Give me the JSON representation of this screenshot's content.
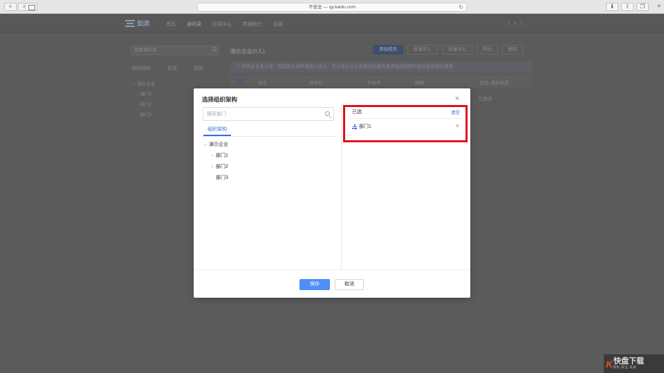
{
  "browser": {
    "url": "不安全 — qy.baidu.com",
    "back_label": "<",
    "forward_label": ">",
    "reload_label": "↻",
    "newtab_label": "+"
  },
  "app": {
    "logo": "如流",
    "nav": [
      "首页",
      "通讯录",
      "应用中心",
      "数据统计",
      "设置"
    ],
    "nav_active_index": 1,
    "nav_right": "\\ = \\",
    "sidebar": {
      "search_placeholder": "搜索通讯录",
      "tabs": [
        "组织结构",
        "标签",
        "高管"
      ],
      "tree_root": "演示企业",
      "tree_children": [
        "部门1",
        "部门2",
        "部门3"
      ]
    },
    "main": {
      "title": "演示企业(0人)",
      "buttons": [
        "添加成员",
        "批量导入",
        "批量导出",
        "移动",
        "删除"
      ],
      "notice": "你的企业未认证，需成员主动申请加入企业，去认证企业认证通过后通讯录添加成员即可自动发送短信邀请",
      "columns": [
        "姓名",
        "成员ID",
        "手机号",
        "邮箱",
        "状态: 成员状态"
      ],
      "row_status": "已激活"
    }
  },
  "modal": {
    "title": "选择组织架构",
    "close_label": "×",
    "search_placeholder": "搜索部门",
    "tab_label": "组织架构",
    "tree": {
      "root": "演示企业",
      "children": [
        {
          "label": "部门1",
          "expandable": true
        },
        {
          "label": "部门2",
          "expandable": true
        },
        {
          "label": "部门3",
          "expandable": false
        }
      ]
    },
    "selected_header": "已选",
    "clear_label": "清空",
    "selected_items": [
      "部门1"
    ],
    "save_label": "保存",
    "cancel_label": "取消"
  },
  "watermark": {
    "mark": "K",
    "title": "快盘下载",
    "subtitle": "绿色·安全·高速"
  },
  "colors": {
    "accent": "#4d8ff7",
    "link": "#3a6fd8",
    "highlight": "#e0101a"
  }
}
